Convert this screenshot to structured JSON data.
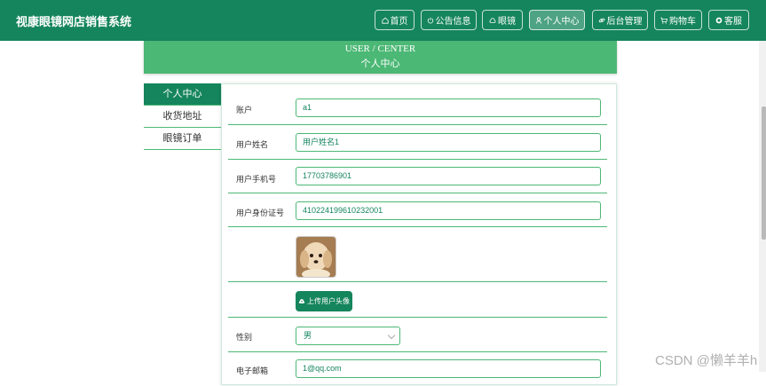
{
  "header": {
    "brand": "视康眼镜网店销售系统",
    "nav": [
      "首页",
      "公告信息",
      "眼镜",
      "个人中心",
      "后台管理",
      "购物车",
      "客服"
    ]
  },
  "banner": {
    "en": "USER / CENTER",
    "cn": "个人中心"
  },
  "sidebar": {
    "items": [
      "个人中心",
      "收货地址",
      "眼镜订单"
    ]
  },
  "form": {
    "account_label": "账户",
    "account_value": "a1",
    "name_label": "用户姓名",
    "name_value": "用户姓名1",
    "phone_label": "用户手机号",
    "phone_value": "17703786901",
    "id_label": "用户身份证号",
    "id_value": "410224199610232001",
    "upload_label": "上传用户头像",
    "gender_label": "性别",
    "gender_value": "男",
    "email_label": "电子邮箱",
    "email_value": "1@qq.com"
  },
  "watermark": "CSDN @懒羊羊h",
  "colors": {
    "primary": "#15855d",
    "accent": "#4cb875"
  }
}
